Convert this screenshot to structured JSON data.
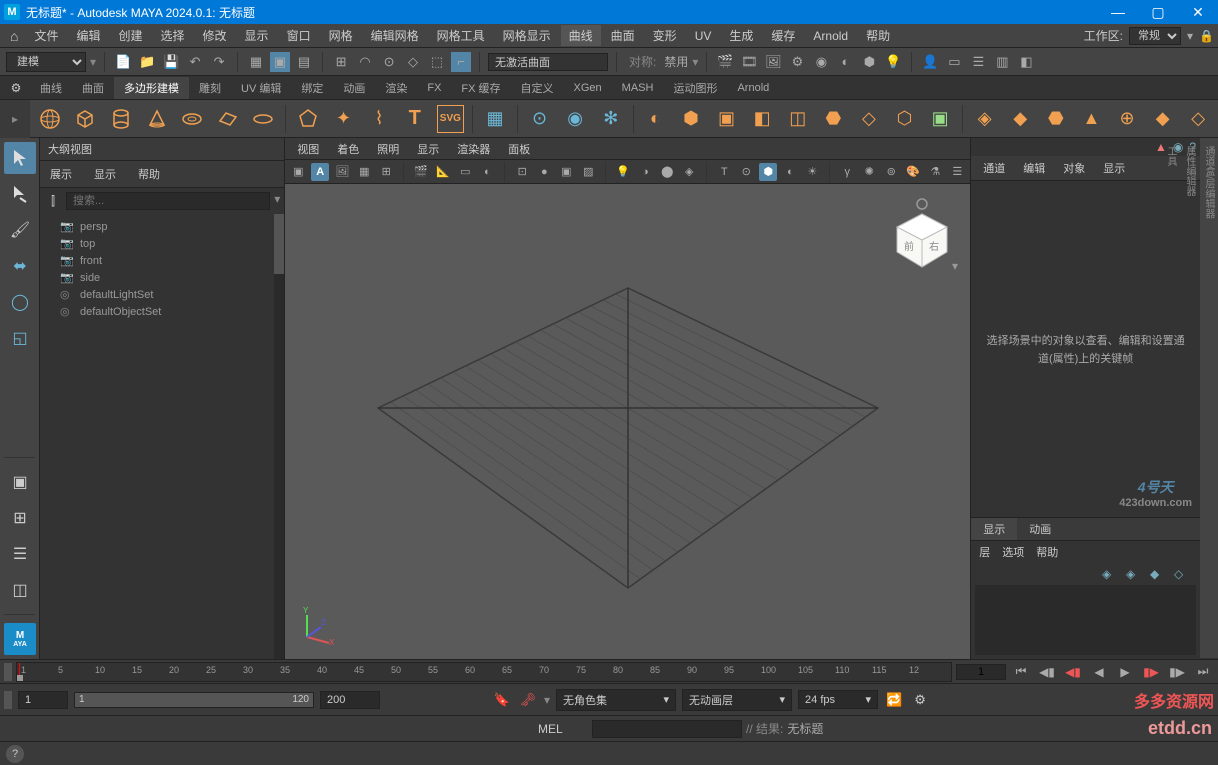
{
  "title": "无标题* - Autodesk MAYA 2024.0.1: 无标题",
  "menus": [
    "文件",
    "编辑",
    "创建",
    "选择",
    "修改",
    "显示",
    "窗口",
    "网格",
    "编辑网格",
    "网格工具",
    "网格显示",
    "曲线",
    "曲面",
    "变形",
    "UV",
    "生成",
    "缓存",
    "Arnold",
    "帮助"
  ],
  "workspace": {
    "label": "工作区:",
    "value": "常规"
  },
  "module_dropdown": "建模",
  "toolbar_field": "无激活曲面",
  "symmetry": {
    "label": "对称:",
    "value": "禁用"
  },
  "shelf_tabs": [
    "曲线",
    "曲面",
    "多边形建模",
    "雕刻",
    "UV 编辑",
    "绑定",
    "动画",
    "渲染",
    "FX",
    "FX 缓存",
    "自定义",
    "XGen",
    "MASH",
    "运动图形",
    "Arnold"
  ],
  "shelf_active": 2,
  "outliner": {
    "title": "大纲视图",
    "tabs": [
      "展示",
      "显示",
      "帮助"
    ],
    "search_placeholder": "搜索...",
    "items": [
      {
        "icon": "cam",
        "name": "persp"
      },
      {
        "icon": "cam",
        "name": "top"
      },
      {
        "icon": "cam",
        "name": "front"
      },
      {
        "icon": "cam",
        "name": "side"
      },
      {
        "icon": "set",
        "name": "defaultLightSet"
      },
      {
        "icon": "set",
        "name": "defaultObjectSet"
      }
    ]
  },
  "viewport_menu": [
    "视图",
    "着色",
    "照明",
    "显示",
    "渲染器",
    "面板"
  ],
  "channel_box": {
    "tabs": [
      "通道",
      "编辑",
      "对象",
      "显示"
    ],
    "message": "选择场景中的对象以查看、编辑和设置通道(属性)上的关键帧",
    "watermark1_top": "4号天",
    "watermark1_bottom": "423down.com"
  },
  "layer_editor": {
    "tabs": [
      "显示",
      "动画"
    ],
    "menu": [
      "层",
      "选项",
      "帮助"
    ]
  },
  "right_tabs": [
    "通道盒/层编辑器",
    "属性编辑器",
    "工具"
  ],
  "timeline": {
    "ticks": [
      1,
      5,
      10,
      15,
      20,
      25,
      30,
      35,
      40,
      45,
      50,
      55,
      60,
      65,
      70,
      75,
      80,
      85,
      90,
      95,
      100,
      105,
      110,
      115,
      12
    ],
    "current_frame": "1"
  },
  "range": {
    "start": "1",
    "end": "120",
    "total": "200"
  },
  "color_set": "无角色集",
  "anim_layer": "无动画层",
  "fps": "24 fps",
  "cmd": {
    "lang": "MEL",
    "result_label": "// 结果:",
    "result_value": "无标题"
  },
  "watermark2_top": "多多资源网",
  "watermark2_bottom": "etdd.cn"
}
